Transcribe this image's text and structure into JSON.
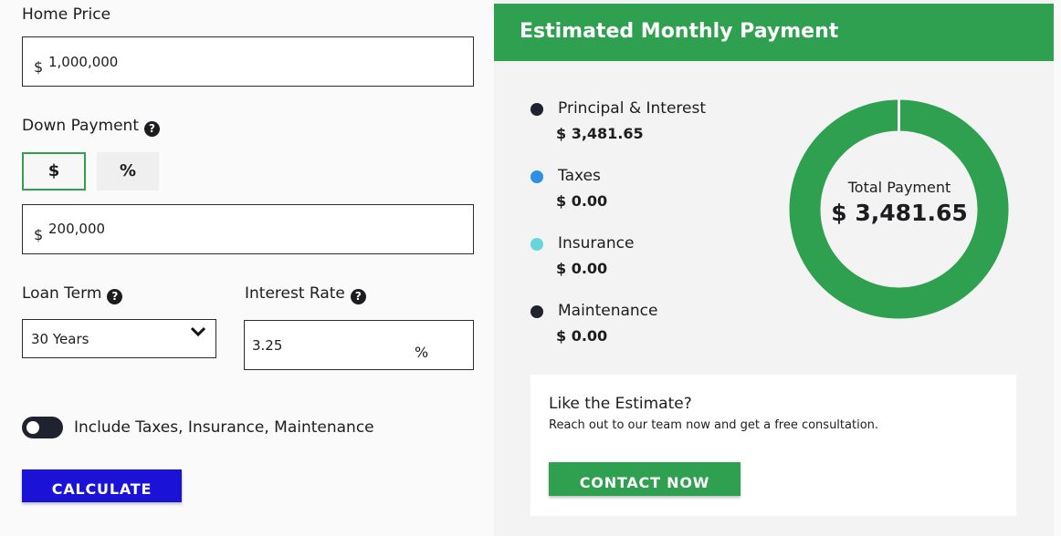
{
  "form": {
    "home_price": {
      "label": "Home Price",
      "currency": "$",
      "value": "1,000,000"
    },
    "down_payment": {
      "label": "Down Payment",
      "help": "?",
      "mode_dollar": "$",
      "mode_percent": "%",
      "selected_mode": "$",
      "currency": "$",
      "value": "200,000"
    },
    "loan_term": {
      "label": "Loan Term",
      "help": "?",
      "value": "30 Years"
    },
    "interest_rate": {
      "label": "Interest Rate",
      "help": "?",
      "value": "3.25",
      "unit": "%"
    },
    "include_toggle": {
      "label": "Include Taxes, Insurance, Maintenance",
      "on": false
    },
    "calculate_label": "CALCULATE"
  },
  "result": {
    "title": "Estimated Monthly Payment",
    "legend": [
      {
        "name": "Principal & Interest",
        "value": "$ 3,481.65",
        "color": "#1f2330"
      },
      {
        "name": "Taxes",
        "value": "$ 0.00",
        "color": "#2f8fe5"
      },
      {
        "name": "Insurance",
        "value": "$ 0.00",
        "color": "#67d6dc"
      },
      {
        "name": "Maintenance",
        "value": "$ 0.00",
        "color": "#1f2330"
      }
    ],
    "total_label": "Total Payment",
    "total_value": "$ 3,481.65",
    "donut_color": "#2ea04f",
    "cta": {
      "title": "Like the Estimate?",
      "text": "Reach out to our team now and get a free consultation.",
      "button": "CONTACT NOW"
    }
  }
}
